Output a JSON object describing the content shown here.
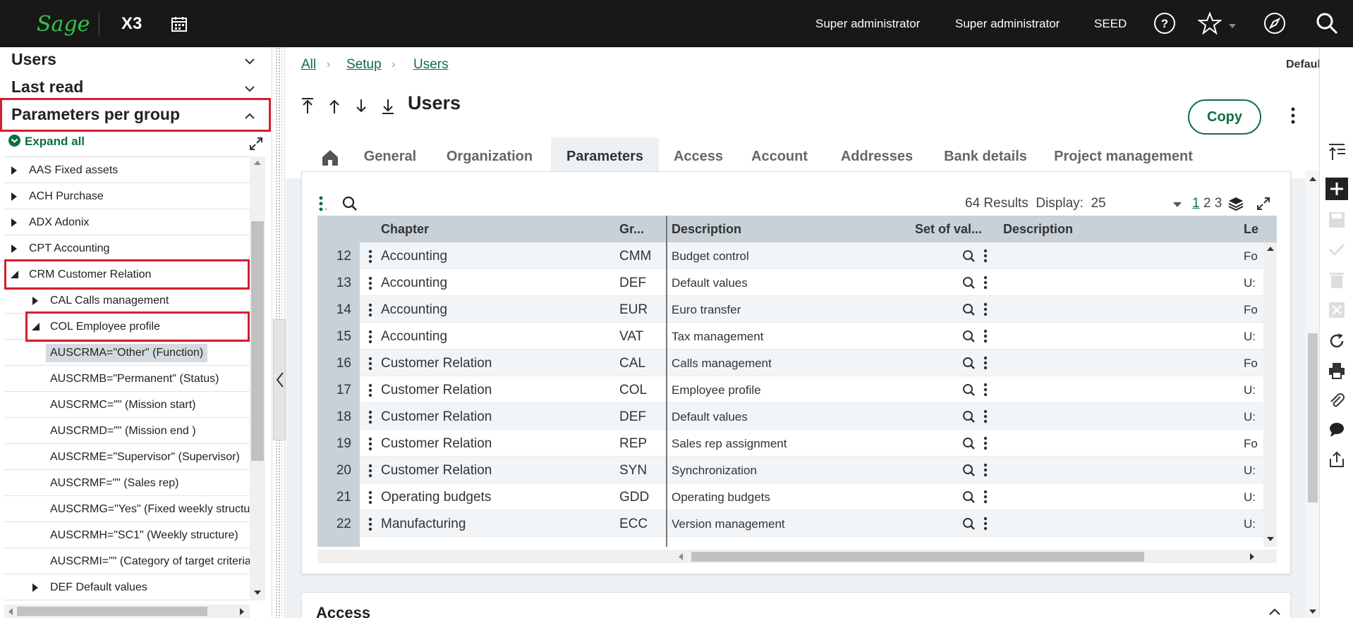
{
  "topbar": {
    "logo": "Sage",
    "product": "X3",
    "user1": "Super administrator",
    "user2": "Super administrator",
    "folder": "SEED"
  },
  "left": {
    "section_users": "Users",
    "section_last_read": "Last read",
    "section_params": "Parameters per group",
    "expand_all": "Expand all",
    "tree": [
      {
        "label": "AAS Fixed assets"
      },
      {
        "label": "ACH Purchase"
      },
      {
        "label": "ADX Adonix"
      },
      {
        "label": "CPT Accounting"
      },
      {
        "label": "CRM Customer Relation"
      },
      {
        "label": "CAL Calls management"
      },
      {
        "label": "COL Employee profile"
      },
      {
        "label": "AUSCRMA=\"Other\" (Function)"
      },
      {
        "label": "AUSCRMB=\"Permanent\" (Status)"
      },
      {
        "label": "AUSCRMC=\"\" (Mission start)"
      },
      {
        "label": "AUSCRMD=\"\" (Mission end )"
      },
      {
        "label": "AUSCRME=\"Supervisor\" (Supervisor)"
      },
      {
        "label": "AUSCRMF=\"\" (Sales rep)"
      },
      {
        "label": "AUSCRMG=\"Yes\" (Fixed weekly structure)"
      },
      {
        "label": "AUSCRMH=\"SC1\" (Weekly structure)"
      },
      {
        "label": "AUSCRMI=\"\" (Category of target criteria)"
      },
      {
        "label": "DEF Default values"
      }
    ]
  },
  "main": {
    "breadcrumb": [
      "All",
      "Setup",
      "Users"
    ],
    "view_selector": "Default",
    "title": "Users",
    "copy_label": "Copy",
    "tabs": [
      "General",
      "Organization",
      "Parameters",
      "Access",
      "Account",
      "Addresses",
      "Bank details",
      "Project management"
    ],
    "grid": {
      "results_text": "64 Results",
      "display_label": "Display:",
      "display_value": "25",
      "pages": [
        "1",
        "2",
        "3"
      ],
      "headers": [
        "Chapter",
        "Gr...",
        "Description",
        "Set of val...",
        "Description",
        "Le"
      ],
      "rows": [
        {
          "num": "12",
          "chapter": "Accounting",
          "group": "CMM",
          "description": "Budget control",
          "level": "Fo"
        },
        {
          "num": "13",
          "chapter": "Accounting",
          "group": "DEF",
          "description": "Default values",
          "level": "U:"
        },
        {
          "num": "14",
          "chapter": "Accounting",
          "group": "EUR",
          "description": "Euro transfer",
          "level": "Fo"
        },
        {
          "num": "15",
          "chapter": "Accounting",
          "group": "VAT",
          "description": "Tax management",
          "level": "U:"
        },
        {
          "num": "16",
          "chapter": "Customer Relation",
          "group": "CAL",
          "description": "Calls management",
          "level": "Fo"
        },
        {
          "num": "17",
          "chapter": "Customer Relation",
          "group": "COL",
          "description": "Employee profile",
          "level": "U:"
        },
        {
          "num": "18",
          "chapter": "Customer Relation",
          "group": "DEF",
          "description": "Default values",
          "level": "U:"
        },
        {
          "num": "19",
          "chapter": "Customer Relation",
          "group": "REP",
          "description": "Sales rep assignment",
          "level": "Fo"
        },
        {
          "num": "20",
          "chapter": "Customer Relation",
          "group": "SYN",
          "description": "Synchronization",
          "level": "U:"
        },
        {
          "num": "21",
          "chapter": "Operating budgets",
          "group": "GDD",
          "description": "Operating budgets",
          "level": "U:"
        },
        {
          "num": "22",
          "chapter": "Manufacturing",
          "group": "ECC",
          "description": "Version management",
          "level": "U:"
        }
      ]
    },
    "section2_title": "Access"
  },
  "colors": {
    "brand_green": "#0b7040",
    "sage_green": "#35c24a",
    "topbar": "#181818",
    "highlight_red": "#d32030"
  }
}
